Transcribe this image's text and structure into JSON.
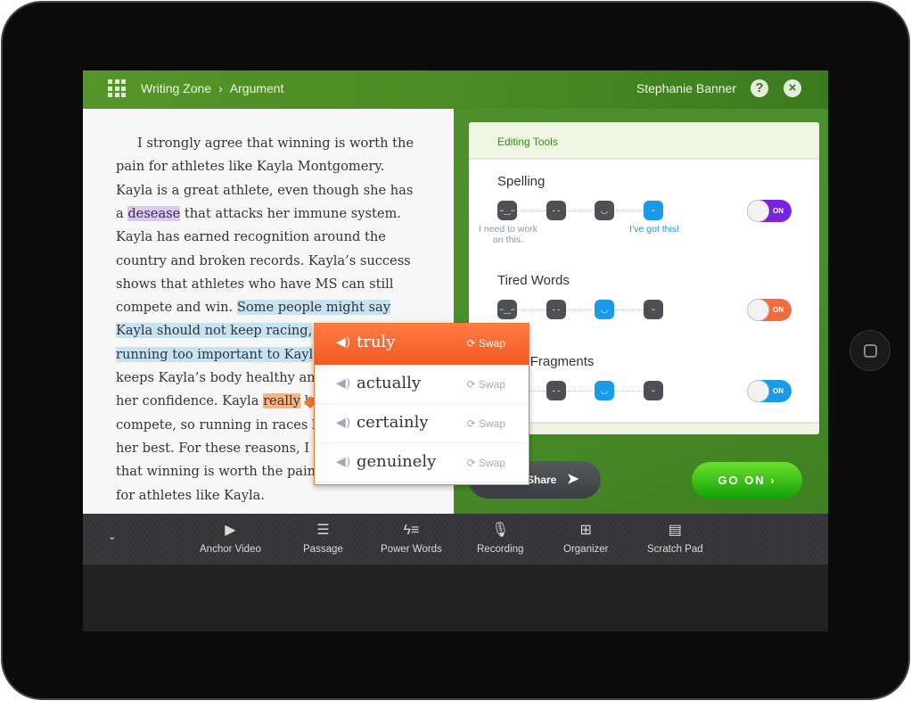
{
  "header": {
    "breadcrumb": [
      "Writing Zone",
      "Argument"
    ],
    "user_name": "Stephanie Banner"
  },
  "passage": {
    "lines": [
      [
        {
          "t": "I strongly agree that winning is worth the"
        }
      ],
      [
        {
          "t": "pain for athletes like Kayla Montgomery."
        }
      ],
      [
        {
          "t": "Kayla is a great athlete, even though she has"
        }
      ],
      [
        {
          "t": "a "
        },
        {
          "t": "desease",
          "hl": "p"
        },
        {
          "t": " that attacks her immune system."
        }
      ],
      [
        {
          "t": "Kayla has earned recognition around the"
        }
      ],
      [
        {
          "t": "country and broken records. Kayla’s success"
        }
      ],
      [
        {
          "t": "shows that athletes who have MS can still"
        }
      ],
      [
        {
          "t": "compete and win. "
        },
        {
          "t": "Some people might say",
          "hl": "b"
        }
      ],
      [
        {
          "t": "Kayla should not keep racing,",
          "hl": "b"
        }
      ],
      [
        {
          "t": "running too important to Kayl",
          "hl": "b"
        }
      ],
      [
        {
          "t": "keeps Kayla’s body healthy an"
        }
      ],
      [
        {
          "t": "her confidence. Kayla "
        },
        {
          "t": "really",
          "hl": "o"
        },
        {
          "t": " lo"
        }
      ],
      [
        {
          "t": "compete, so running in races l"
        }
      ],
      [
        {
          "t": "her best. For these reasons, I s"
        }
      ],
      [
        {
          "t": "that winning is worth the pain"
        }
      ],
      [
        {
          "t": "for athletes like Kayla."
        }
      ]
    ]
  },
  "editing_tools": {
    "title": "Editing Tools",
    "sections": [
      {
        "title": "Spelling",
        "level": 4,
        "toggle": "ON",
        "color": "#7b22e0",
        "low_label": "I need to work on this.",
        "high_label": "I’ve got this!"
      },
      {
        "title": "Tired Words",
        "level": 3,
        "toggle": "ON",
        "color": "#f36b3a"
      },
      {
        "title": "ence Fragments",
        "level": 3,
        "toggle": "ON",
        "color": "#1a9be8"
      }
    ]
  },
  "popup": {
    "options": [
      {
        "word": "truly",
        "swap": "Swap",
        "active": true
      },
      {
        "word": "actually",
        "swap": "Swap"
      },
      {
        "word": "certainly",
        "swap": "Swap"
      },
      {
        "word": "genuinely",
        "swap": "Swap"
      }
    ]
  },
  "actions": {
    "share": "Share",
    "go_on": "GO ON ›"
  },
  "toolbar": {
    "items": [
      "Anchor Video",
      "Passage",
      "Power Words",
      "Recording",
      "Organizer",
      "Scratch Pad"
    ]
  }
}
